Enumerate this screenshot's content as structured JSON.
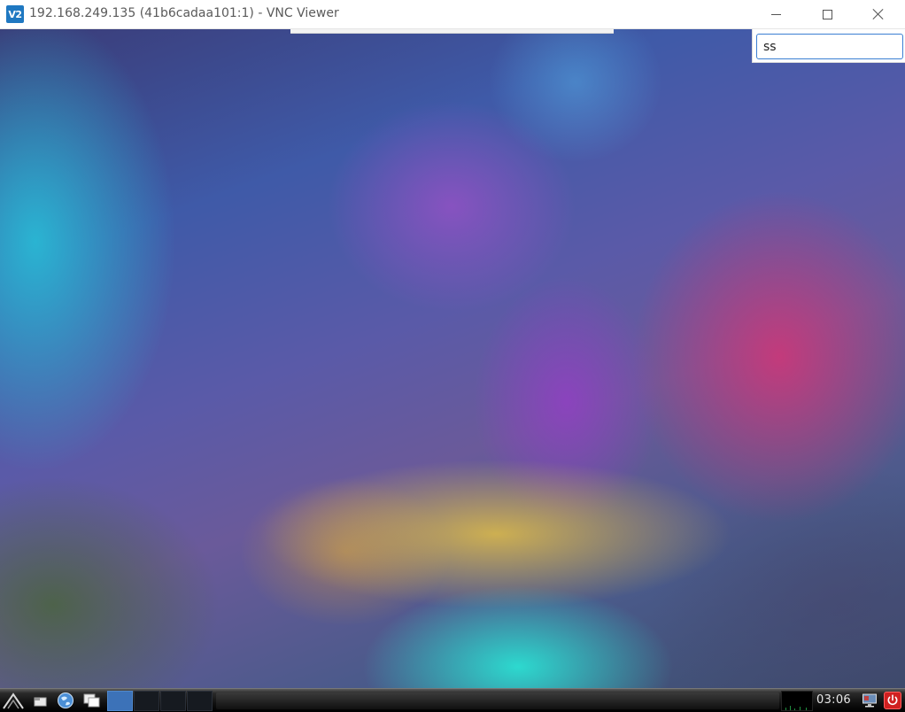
{
  "window": {
    "app_icon_text": "V2",
    "title": "192.168.249.135 (41b6cadaa101:1) - VNC Viewer",
    "controls": {
      "minimize": "minimize-icon",
      "maximize": "maximize-icon",
      "close": "close-icon"
    }
  },
  "search": {
    "value": "ss"
  },
  "taskbar": {
    "start_icon": "start-menu-icon",
    "launchers": [
      "show-desktop-icon",
      "web-browser-icon",
      "window-list-icon"
    ],
    "workspaces": [
      {
        "active": true
      },
      {
        "active": false
      },
      {
        "active": false
      },
      {
        "active": false
      }
    ],
    "clock": "03:06",
    "tray_icons": [
      "monitor-icon",
      "power-icon"
    ]
  },
  "colors": {
    "accent": "#3b7fd3",
    "app_icon": "#1f78c1",
    "active_workspace": "#3c72b8",
    "power_button": "#d02020"
  }
}
